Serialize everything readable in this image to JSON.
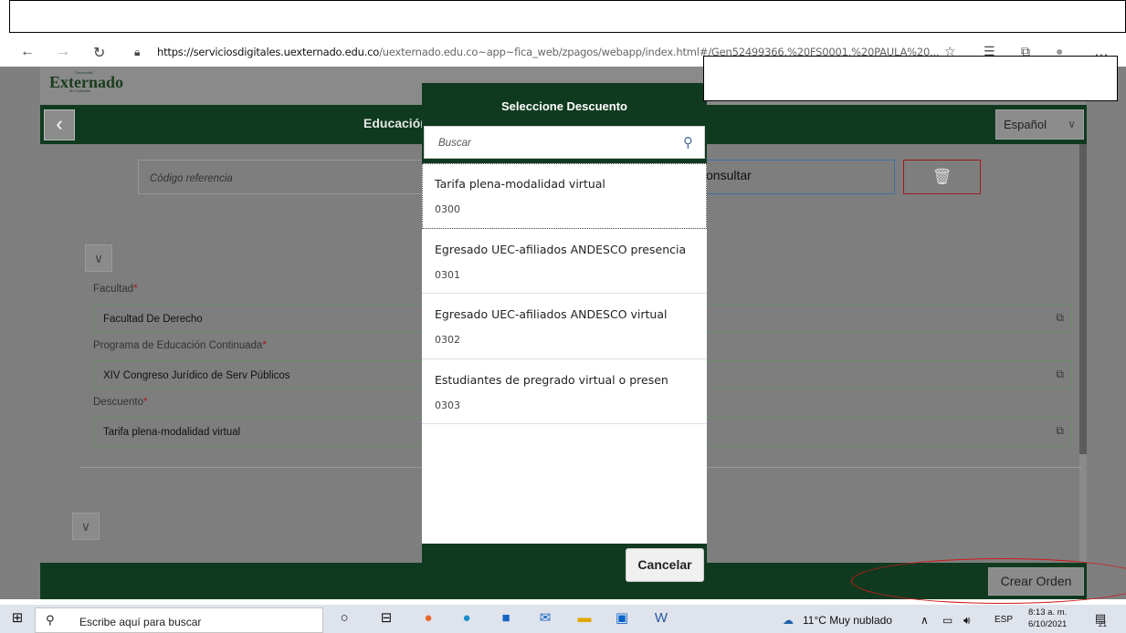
{
  "browser": {
    "url_host": "https://serviciosdigitales.uexternado.edu.co",
    "url_rest": "/uexternado.edu.co~app~fica_web/zpagos/webapp/index.html#/Gen52499366,%20FS0001,%20PAULA%20..."
  },
  "app": {
    "logo": "Externado",
    "logo_top": "Universidad",
    "logo_sub": "de Colombia",
    "title": "Educación",
    "language": "Español",
    "codigo_placeholder": "Código referencia",
    "consultar_label": "onsultar",
    "create_order_label": "Crear Orden"
  },
  "form": {
    "facultad_label": "Facultad",
    "facultad_value": "Facultad De Derecho",
    "programa_label": "Programa de Educación Continuada",
    "programa_value": "XIV Congreso Jurídico de Serv Públicos",
    "descuento_label": "Descuento",
    "descuento_value": "Tarifa plena-modalidad  virtual",
    "required_mark": "*"
  },
  "dialog": {
    "title": "Seleccione Descuento",
    "search_placeholder": "Buscar",
    "cancel_label": "Cancelar",
    "items": [
      {
        "title": "Tarifa plena-modalidad virtual",
        "code": "0300"
      },
      {
        "title": "Egresado UEC-afiliados ANDESCO presencia",
        "code": "0301"
      },
      {
        "title": "Egresado UEC-afiliados ANDESCO virtual",
        "code": "0302"
      },
      {
        "title": "Estudiantes de pregrado virtual o presen",
        "code": "0303"
      }
    ]
  },
  "taskbar": {
    "search_placeholder": "Escribe aquí para buscar",
    "weather": "11°C  Muy nublado",
    "lang": "ESP",
    "time": "8:13 a. m.",
    "date": "6/10/2021",
    "notifications": "21"
  },
  "colors": {
    "brand_green": "#0f3a1f",
    "annotation_red": "#d01818"
  }
}
